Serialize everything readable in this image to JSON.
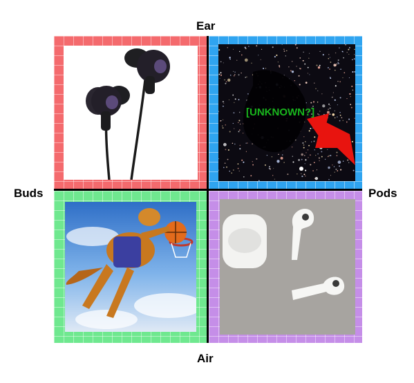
{
  "axes": {
    "top": "Ear",
    "bottom": "Air",
    "left": "Buds",
    "right": "Pods"
  },
  "quadrants": {
    "top_left": {
      "image": "black-earbuds-photo",
      "color": "#f46a6d"
    },
    "top_right": {
      "image": "dark-starfield-photo",
      "annotation": "[UNKNOWN?]",
      "color": "#2fa4f0",
      "arrow_color": "#e8140f"
    },
    "bottom_left": {
      "image": "dog-dunking-basketball-photo",
      "color": "#6fe88f"
    },
    "bottom_right": {
      "image": "white-wireless-earbuds-photo",
      "color": "#c58ee8"
    }
  }
}
